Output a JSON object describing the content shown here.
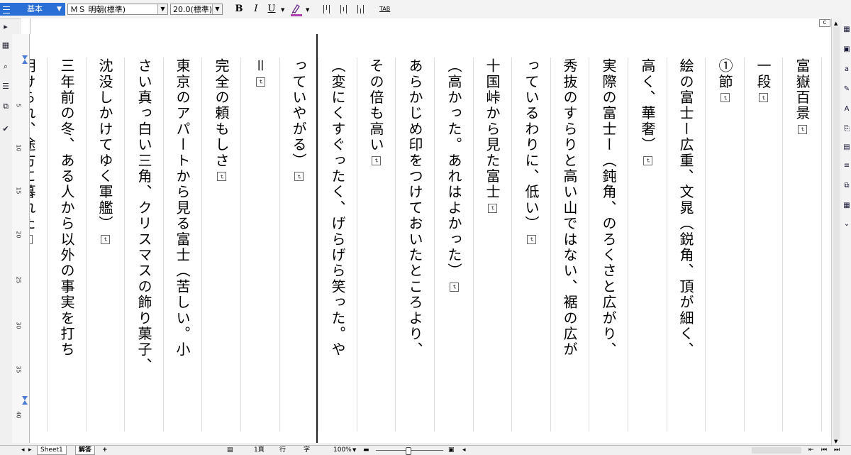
{
  "toolbar": {
    "style_label": "基本",
    "font_name": "ＭＳ 明朝(標準)",
    "font_size": "20.0(標準)",
    "bold_label": "B",
    "italic_label": "I",
    "underline_label": "U",
    "tab_label": "TAB",
    "color_accent": "#2a6fd6"
  },
  "ruler": {
    "corner_label": "C",
    "vertical_numbers": [
      "5",
      "10",
      "15",
      "20",
      "25",
      "30",
      "35",
      "40"
    ]
  },
  "document": {
    "columns": [
      {
        "text": "富嶽百景",
        "ret": true
      },
      {
        "text": "一段",
        "ret": true
      },
      {
        "text": "①節",
        "ret": true
      },
      {
        "text": "絵の富士ー広重、文晁（鋭角、頂が細く、",
        "ret": false
      },
      {
        "text": "高く、華奢）",
        "ret": true
      },
      {
        "text": "実際の富士ー（鈍角、のろくさと広がり、",
        "ret": false
      },
      {
        "text": "秀抜のすらりと高い山ではない、裾の広が",
        "ret": false
      },
      {
        "text": "っているわりに、低い）",
        "ret": true
      },
      {
        "text": "十国峠から見た富士",
        "ret": true
      },
      {
        "text": "（高かった。あれはよかった）",
        "ret": true
      },
      {
        "text": "あらかじめ印をつけておいたところより、",
        "ret": false
      },
      {
        "text": "その倍も高い",
        "ret": true
      },
      {
        "text": "（変にくすぐったく、げらげら笑った。や",
        "ret": false
      },
      {
        "text": "っていやがる）",
        "ret": true
      },
      {
        "text": "＝",
        "ret": true
      },
      {
        "text": "完全の頼もしさ",
        "ret": true
      },
      {
        "text": "東京のアパートから見る富士（苦しい。小",
        "ret": false
      },
      {
        "text": "さい真っ白い三角、クリスマスの飾り菓子、",
        "ret": false
      },
      {
        "text": "沈没しかけてゆく軍艦）",
        "ret": true
      },
      {
        "text": "三年前の冬、ある人から以外の事実を打ち",
        "ret": false
      },
      {
        "text": "明けられ、途方に暮れた",
        "ret": true
      }
    ]
  },
  "statusbar": {
    "sheet1_label": "Sheet1",
    "sheet2_label": "解答",
    "add_sheet_label": "+",
    "page_label": "1頁",
    "line_label": "行",
    "char_label": "字",
    "zoom_label": "100%"
  }
}
